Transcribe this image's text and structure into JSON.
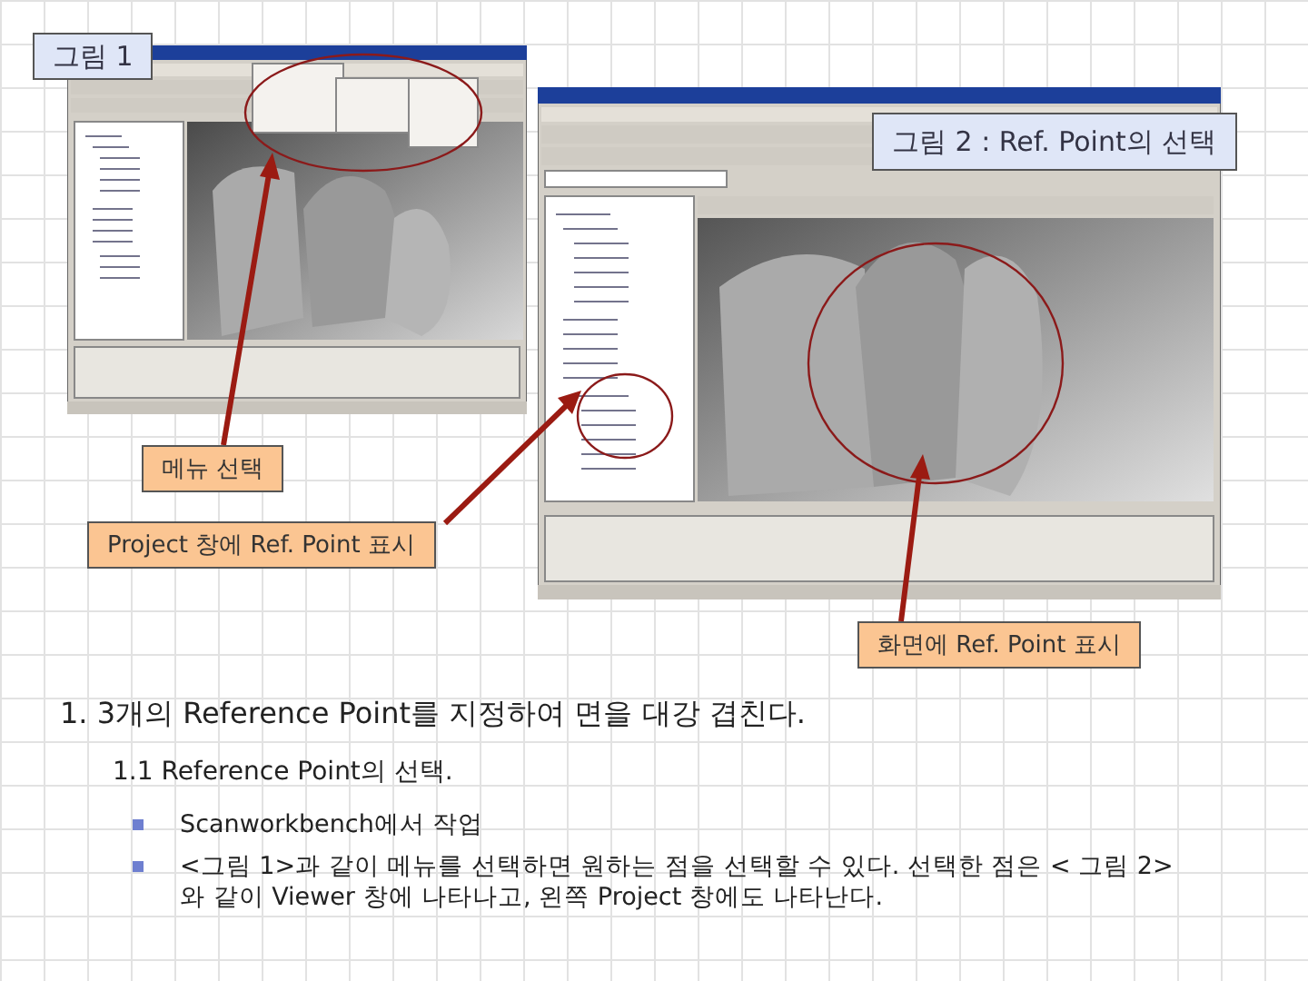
{
  "callouts": [
    {
      "kind": "figure",
      "text": "그림 1"
    },
    {
      "kind": "figure",
      "text": "그림 2 : Ref. Point의 선택"
    },
    {
      "kind": "note",
      "text": "메뉴 선택"
    },
    {
      "kind": "note",
      "text": "Project 창에 Ref. Point 표시"
    },
    {
      "kind": "note",
      "text": "화면에 Ref. Point 표시"
    }
  ],
  "heading": "1. 3개의 Reference Point를 지정하여 면을 대강 겹친다.",
  "subheading": "1.1 Reference Point의 선택.",
  "bullets": [
    "Scanworkbench에서 작업",
    "<그림 1>과 같이 메뉴를 선택하면 원하는 점을 선택할 수 있다. 선택한 점은 < 그림 2>와 같이 Viewer 창에 나타나고, 왼쪽 Project 창에도 나타난다."
  ]
}
